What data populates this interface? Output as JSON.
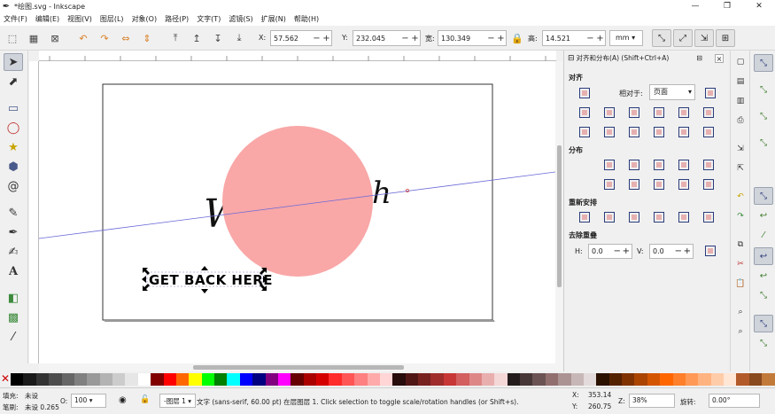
{
  "window": {
    "title": "*绘图.svg - Inkscape",
    "controls": [
      "—",
      "❐",
      "✕"
    ]
  },
  "menubar": [
    "文件(F)",
    "编辑(E)",
    "视图(V)",
    "图层(L)",
    "对象(O)",
    "路径(P)",
    "文字(T)",
    "滤镜(S)",
    "扩展(N)",
    "帮助(H)"
  ],
  "toolbar": {
    "x_label": "X:",
    "x_value": "57.562",
    "y_label": "Y:",
    "y_value": "232.045",
    "w_label": "宽:",
    "w_value": "130.349",
    "h_label": "高:",
    "h_value": "14.521",
    "unit": "mm",
    "minus": "−",
    "plus": "+"
  },
  "canvas": {
    "script_text": "W",
    "script_text_end": "h",
    "selected_text": "GET BACK HERE",
    "circle_color": "#f9a7a7"
  },
  "align_dialog": {
    "title": "对齐和分布(A) (Shift+Ctrl+A)",
    "section_align": "对齐",
    "relative_to_label": "相对于:",
    "relative_to_value": "页面",
    "section_distribute": "分布",
    "section_rearrange": "重新安排",
    "section_remove_overlap": "去除重叠",
    "h_label": "H:",
    "h_value": "0.0",
    "v_label": "V:",
    "v_value": "0.0",
    "minus": "−",
    "plus": "+"
  },
  "palette": [
    "#000000",
    "#1a1a1a",
    "#333333",
    "#4d4d4d",
    "#666666",
    "#808080",
    "#999999",
    "#b3b3b3",
    "#cccccc",
    "#e6e6e6",
    "#ffffff",
    "#800000",
    "#ff0000",
    "#ff6600",
    "#ffff00",
    "#00ff00",
    "#008000",
    "#00ffff",
    "#0000ff",
    "#000080",
    "#800080",
    "#ff00ff",
    "#660000",
    "#aa0000",
    "#d40000",
    "#ff2a2a",
    "#ff5555",
    "#ff8080",
    "#ffaaaa",
    "#ffd5d5",
    "#280b0b",
    "#501616",
    "#782121",
    "#a02c2c",
    "#c83737",
    "#d35f5f",
    "#de8787",
    "#e9afaf",
    "#f4d7d7",
    "#241c1c",
    "#483737",
    "#6c5353",
    "#916f6f",
    "#ac9393",
    "#c8b7b7",
    "#e3dbdb",
    "#2b1100",
    "#552200",
    "#803300",
    "#aa4400",
    "#d45500",
    "#ff6600",
    "#ff7f2a",
    "#ff9955",
    "#ffb380",
    "#ffccaa",
    "#ffe6d5",
    "#b35a2a",
    "#8a4a1f",
    "#c27a3a"
  ],
  "statusbar": {
    "fill_label": "填充:",
    "fill_value": "未设",
    "stroke_label": "笔刷:",
    "stroke_value": "未设 0.265",
    "opacity_label": "O:",
    "opacity_value": "100",
    "layer_value": "-图层 1",
    "message": "文字 (sans-serif, 60.00 pt) 在层图层 1. Click selection to toggle scale/rotation handles (or Shift+s).",
    "x_label": "X:",
    "x_value": "353.14",
    "y_label": "Y:",
    "y_value": "260.75",
    "z_label": "Z:",
    "zoom_value": "38%",
    "rotation_label": "旋转:",
    "rotation_value": "0.00°"
  }
}
